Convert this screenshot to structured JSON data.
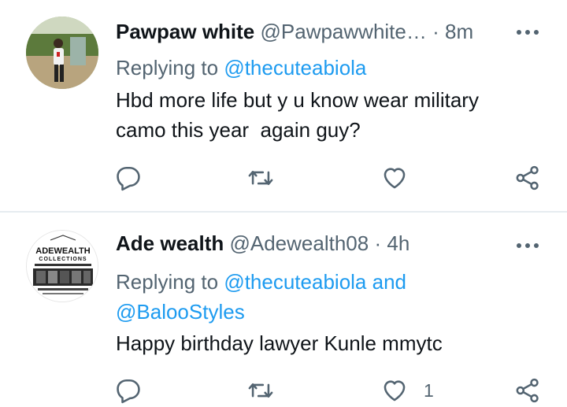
{
  "tweets": [
    {
      "name": "Pawpaw white",
      "handle": "@Pawpawwhite…",
      "separator": "·",
      "time": "8m",
      "replying_prefix": "Replying to",
      "replying_mention_1": "@thecuteabiola",
      "text": "Hbd more life but y u know wear military\ncamo this year  again guy?",
      "like_count": ""
    },
    {
      "name": "Ade wealth",
      "handle": "@Adewealth08",
      "separator": "·",
      "time": "4h",
      "replying_prefix": "Replying to",
      "replying_mention_1": "@thecuteabiola",
      "replying_and": "and",
      "replying_mention_2": "@BalooStyles",
      "text": "Happy birthday lawyer Kunle mmytc",
      "like_count": "1",
      "avatar_logo_line_1": "ADEWEALTH",
      "avatar_logo_line_2": "COLLECTIONS"
    }
  ],
  "icons": {
    "reply": "reply-icon",
    "retweet": "retweet-icon",
    "like": "heart-icon",
    "share": "share-icon",
    "more": "more-icon"
  },
  "colors": {
    "text": "#0f1419",
    "muted": "#536471",
    "link": "#1d9bf0",
    "divider": "#e6ecf0"
  }
}
